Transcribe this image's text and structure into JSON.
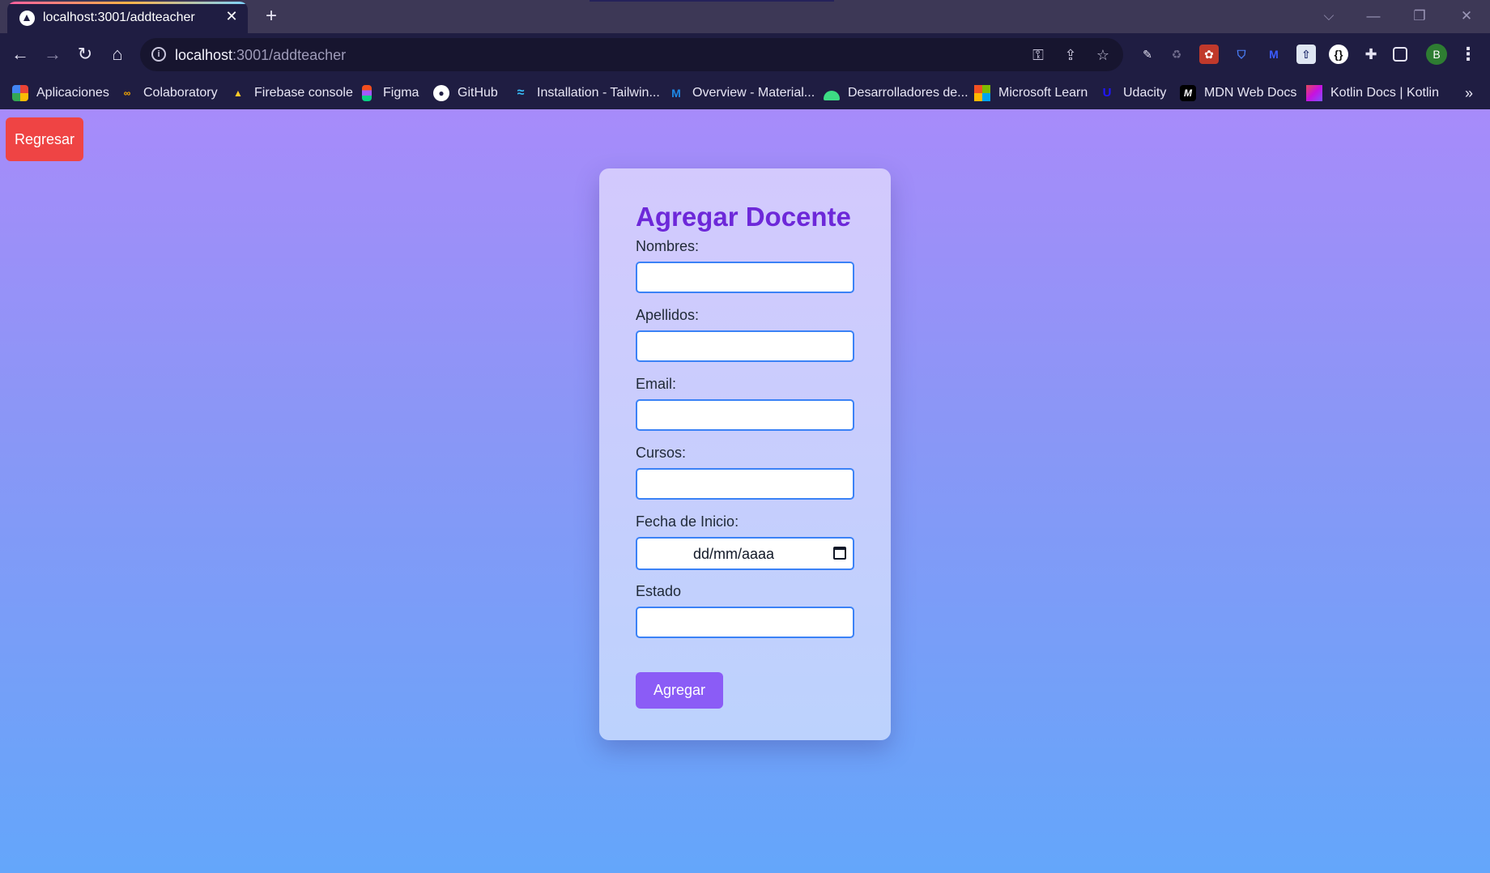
{
  "browser": {
    "tab": {
      "title": "localhost:3001/addteacher",
      "close_glyph": "✕"
    },
    "new_tab_glyph": "+",
    "window_controls": {
      "search_tabs": "⌵",
      "minimize": "—",
      "restore": "❐",
      "close": "✕"
    },
    "nav": {
      "back": "←",
      "forward": "→",
      "reload": "↻",
      "home": "⌂"
    },
    "address": {
      "info_glyph": "i",
      "host": "localhost",
      "path": ":3001/addteacher"
    },
    "omnibox_icons": {
      "key": "⚿",
      "share": "⇪",
      "star": "☆"
    },
    "profile_initial": "B",
    "menu_glyph": "⋮",
    "bookmarks": [
      {
        "label": "Aplicaciones",
        "icon": "apps-grid-icon"
      },
      {
        "label": "Colaboratory",
        "icon": "colab-icon"
      },
      {
        "label": "Firebase console",
        "icon": "firebase-icon"
      },
      {
        "label": "Figma",
        "icon": "figma-icon"
      },
      {
        "label": "GitHub",
        "icon": "github-icon"
      },
      {
        "label": "Installation - Tailwin...",
        "icon": "tailwind-icon"
      },
      {
        "label": "Overview - Material...",
        "icon": "material-ui-icon"
      },
      {
        "label": "Desarrolladores de...",
        "icon": "android-icon"
      },
      {
        "label": "Microsoft Learn",
        "icon": "microsoft-icon"
      },
      {
        "label": "Udacity",
        "icon": "udacity-icon"
      },
      {
        "label": "MDN Web Docs",
        "icon": "mdn-icon"
      },
      {
        "label": "Kotlin Docs | Kotlin",
        "icon": "kotlin-icon"
      }
    ],
    "bookmarks_more_glyph": "»"
  },
  "page": {
    "back_button": "Regresar",
    "form": {
      "title": "Agregar Docente",
      "fields": {
        "nombres": {
          "label": "Nombres:",
          "value": ""
        },
        "apellidos": {
          "label": "Apellidos:",
          "value": ""
        },
        "email": {
          "label": "Email:",
          "value": ""
        },
        "cursos": {
          "label": "Cursos:",
          "value": ""
        },
        "fecha": {
          "label": "Fecha de Inicio:",
          "placeholder": "dd/mm/aaaa"
        },
        "estado": {
          "label": "Estado",
          "value": ""
        }
      },
      "submit": "Agregar"
    }
  },
  "colors": {
    "back_button": "#ef4444",
    "title": "#6d28d9",
    "submit_button": "#8b5cf6",
    "input_border": "#3b82f6"
  }
}
